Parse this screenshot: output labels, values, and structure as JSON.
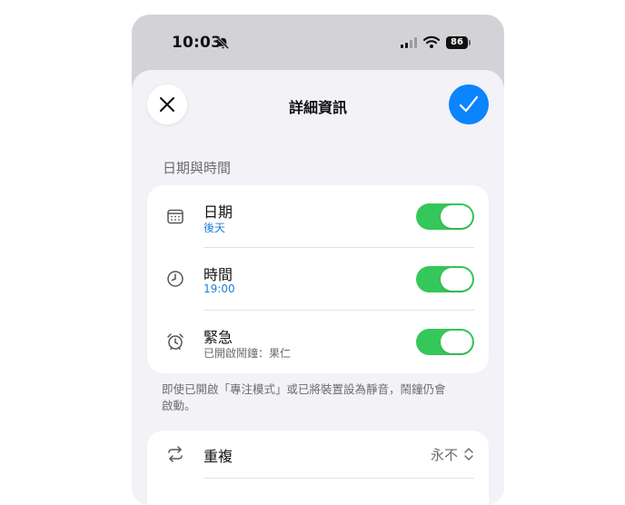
{
  "status_bar": {
    "time": "10:03",
    "battery": "86"
  },
  "sheet": {
    "title": "詳細資訊"
  },
  "date_time_section": {
    "header": "日期與時間",
    "rows": [
      {
        "title": "日期",
        "subtitle": "後天",
        "toggle_on": true
      },
      {
        "title": "時間",
        "subtitle": "19:00",
        "toggle_on": true
      },
      {
        "title": "緊急",
        "subtitle": "已開啟鬧鐘：果仁",
        "toggle_on": true
      }
    ],
    "footnote": "即使已開啟「專注模式」或已將裝置設為靜音，鬧鐘仍會啟動。"
  },
  "repeat_section": {
    "title": "重複",
    "value": "永不"
  },
  "colors": {
    "accent": "#0a84ff",
    "toggle_on": "#34c759",
    "subtitle_blue": "#1a7fd9"
  },
  "icons": {
    "close": "close-icon",
    "done": "checkmark-icon",
    "date": "calendar-icon",
    "time": "clock-icon",
    "urgent": "alarm-clock-icon",
    "repeat": "repeat-icon"
  }
}
